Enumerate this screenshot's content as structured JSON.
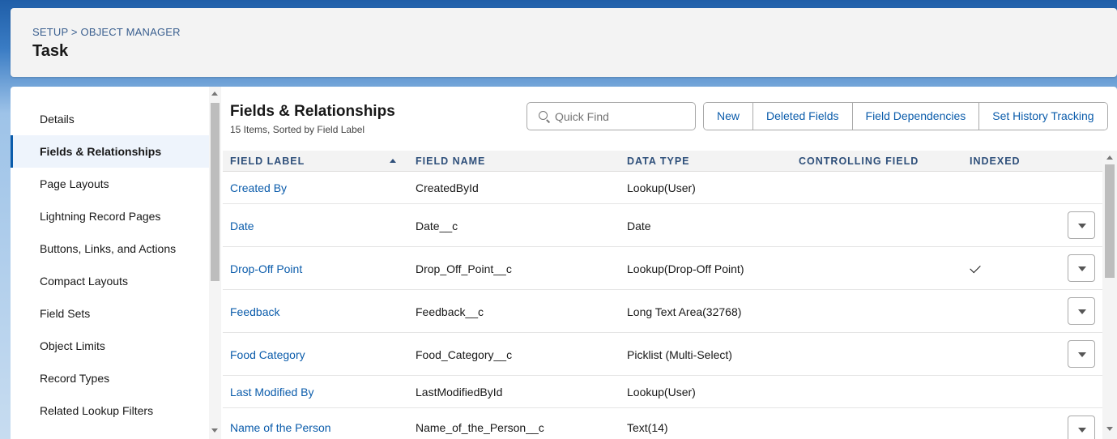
{
  "header": {
    "breadcrumb": [
      "SETUP",
      ">",
      "OBJECT MANAGER"
    ],
    "title": "Task"
  },
  "sidebar": {
    "items": [
      {
        "label": "Details"
      },
      {
        "label": "Fields & Relationships",
        "active": true
      },
      {
        "label": "Page Layouts"
      },
      {
        "label": "Lightning Record Pages"
      },
      {
        "label": "Buttons, Links, and Actions"
      },
      {
        "label": "Compact Layouts"
      },
      {
        "label": "Field Sets"
      },
      {
        "label": "Object Limits"
      },
      {
        "label": "Record Types"
      },
      {
        "label": "Related Lookup Filters"
      }
    ]
  },
  "content": {
    "title": "Fields & Relationships",
    "subtitle": "15 Items, Sorted by Field Label",
    "search_placeholder": "Quick Find",
    "buttons": [
      "New",
      "Deleted Fields",
      "Field Dependencies",
      "Set History Tracking"
    ]
  },
  "table": {
    "columns": [
      "FIELD LABEL",
      "FIELD NAME",
      "DATA TYPE",
      "CONTROLLING FIELD",
      "INDEXED"
    ],
    "sort_icon": "sort-ascending-icon",
    "rows": [
      {
        "label": "Created By",
        "name": "CreatedById",
        "type": "Lookup(User)",
        "controlling": "",
        "indexed": false,
        "menu": false
      },
      {
        "label": "Date",
        "name": "Date__c",
        "type": "Date",
        "controlling": "",
        "indexed": false,
        "menu": true
      },
      {
        "label": "Drop-Off Point",
        "name": "Drop_Off_Point__c",
        "type": "Lookup(Drop-Off Point)",
        "controlling": "",
        "indexed": true,
        "menu": true
      },
      {
        "label": "Feedback",
        "name": "Feedback__c",
        "type": "Long Text Area(32768)",
        "controlling": "",
        "indexed": false,
        "menu": true
      },
      {
        "label": "Food Category",
        "name": "Food_Category__c",
        "type": "Picklist (Multi-Select)",
        "controlling": "",
        "indexed": false,
        "menu": true
      },
      {
        "label": "Last Modified By",
        "name": "LastModifiedById",
        "type": "Lookup(User)",
        "controlling": "",
        "indexed": false,
        "menu": false
      },
      {
        "label": "Name of the Person",
        "name": "Name_of_the_Person__c",
        "type": "Text(14)",
        "controlling": "",
        "indexed": false,
        "menu": true
      }
    ]
  },
  "colors": {
    "accent": "#0b5cab",
    "header_text": "#2e4f7a",
    "active_bg": "#eef4fc"
  }
}
